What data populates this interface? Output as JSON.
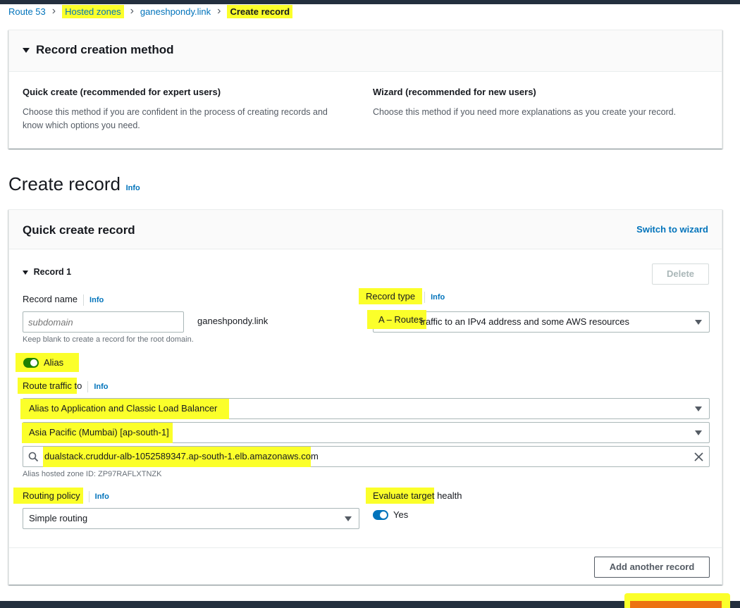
{
  "breadcrumbs": [
    "Route 53",
    "Hosted zones",
    "ganeshpondy.link",
    "Create record"
  ],
  "method_panel": {
    "title": "Record creation method",
    "quick_title": "Quick create (recommended for expert users)",
    "quick_desc_line1": "Choose this method if you are confident in the process of creating records and",
    "quick_desc_line2": "know which options you need.",
    "wizard_title": "Wizard (recommended for new users)",
    "wizard_desc": "Choose this method if you need more explanations as you create your record."
  },
  "page": {
    "title": "Create record",
    "info": "Info"
  },
  "quick_create": {
    "title": "Quick create record",
    "switch_link": "Switch to wizard",
    "record_label": "Record 1",
    "delete_label": "Delete",
    "record_name": {
      "label": "Record name",
      "info": "Info",
      "placeholder": "subdomain",
      "value": "",
      "suffix": "ganeshpondy.link",
      "hint": "Keep blank to create a record for the root domain."
    },
    "record_type": {
      "label_part1": "Record type",
      "info": "Info",
      "value_part1": "A – Routes",
      "value_part2": " traffic to an IPv4 address and some AWS resources"
    },
    "alias": {
      "label": "Alias",
      "enabled": true,
      "color": "#1d8102"
    },
    "route_traffic": {
      "label_part1": "Route traffic t",
      "label_part2": "o",
      "info": "Info",
      "endpoint": "Alias to Application and Classic Load Balancer",
      "region": "Asia Pacific (Mumbai) [ap-south-1]",
      "search_value_part1": "dualstack.cruddur-alb-1052589347.ap-south-1.elb.amazonaws.co",
      "search_value_part2": "m",
      "hosted_zone_id": "Alias hosted zone ID: ZP97RAFLXTNZK"
    },
    "routing_policy": {
      "label": "Routing policy",
      "info": "Info",
      "value": "Simple routing"
    },
    "evaluate_health": {
      "label_part1": "Evaluate target",
      "label_part2": " health",
      "toggle_label": "Yes",
      "enabled": true,
      "color": "#0073bb"
    },
    "add_another": "Add another record"
  },
  "colors": {
    "highlight": "#fbff2a",
    "link": "#0073bb",
    "nav": "#232f3e",
    "cta_bottom": "#ec7211"
  },
  "icons": {
    "search": "search-icon",
    "clear": "close-icon",
    "caret": "caret-down-icon",
    "chevron": "chevron-right-icon"
  }
}
